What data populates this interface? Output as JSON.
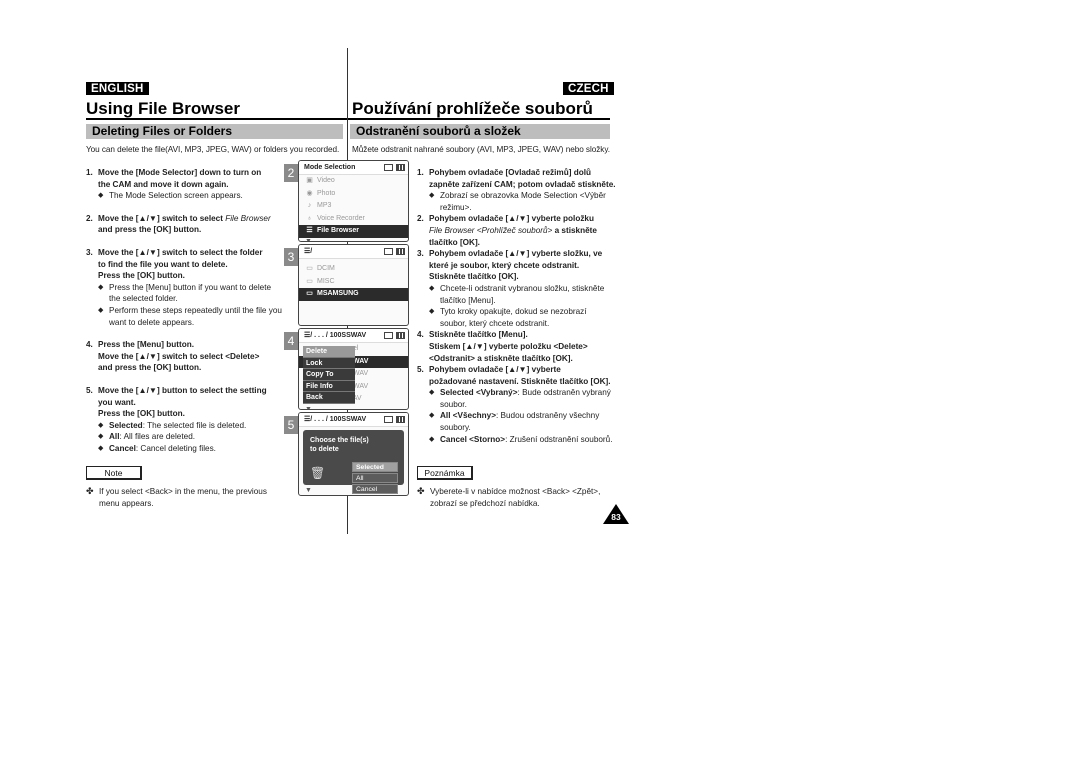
{
  "left": {
    "lang": "ENGLISH",
    "title": "Using File Browser",
    "section": "Deleting Files or Folders",
    "intro": "You can delete the file(AVI, MP3, JPEG, WAV) or folders you recorded.",
    "steps": [
      {
        "num": "1.",
        "lines": [
          "Move the [Mode Selector] down to turn on",
          "the CAM and move it down again."
        ],
        "bullets": [
          "The Mode Selection screen appears."
        ]
      },
      {
        "num": "2.",
        "line1_pre": "Move the [▲/▼] switch to select ",
        "line1_italic": "File Browser",
        "line2": "and press the [OK] button."
      },
      {
        "num": "3.",
        "lines": [
          "Move the [▲/▼] switch to select the folder",
          "to find the file you want to delete.",
          "Press the [OK] button."
        ],
        "bullets": [
          "Press the [Menu] button if you want to delete the selected folder.",
          "Perform these steps repeatedly until the file you want to delete appears."
        ]
      },
      {
        "num": "4.",
        "lines": [
          "Press the [Menu] button.",
          "Move the [▲/▼] switch to select <Delete>",
          "and press the [OK] button."
        ]
      },
      {
        "num": "5.",
        "lines": [
          "Move the [▲/▼] button to select the setting",
          "you want.",
          "Press the [OK] button."
        ],
        "bullets": [
          {
            "term": "Selected",
            "desc": ": The selected file is deleted."
          },
          {
            "term": "All",
            "desc": ": All files are deleted."
          },
          {
            "term": "Cancel",
            "desc": ": Cancel deleting files."
          }
        ]
      }
    ],
    "note_label": "Note",
    "note_text": "If you select <Back> in the menu, the previous menu appears."
  },
  "right": {
    "lang": "CZECH",
    "title": "Používání prohlížeče souborů",
    "section": "Odstranění souborů a složek",
    "intro": "Můžete odstranit nahrané soubory (AVI, MP3, JPEG, WAV) nebo složky.",
    "steps": [
      {
        "num": "1.",
        "lines": [
          "Pohybem ovladače [Ovladač režimů] dolů",
          "zapněte zařízení CAM; potom ovladač stiskněte."
        ],
        "bullets": [
          "Zobrazí se obrazovka Mode Selection <Výběr režimu>."
        ]
      },
      {
        "num": "2.",
        "line1": "Pohybem ovladače [▲/▼] vyberte položku",
        "line2_italic": "File Browser <Prohlížeč souborů>",
        "line2_post": " a stiskněte",
        "line3": "tlačítko [OK]."
      },
      {
        "num": "3.",
        "lines": [
          "Pohybem ovladače [▲/▼] vyberte složku, ve",
          "které je soubor, který chcete odstranit.",
          "Stiskněte tlačítko [OK]."
        ],
        "bullets": [
          "Chcete-li odstranit vybranou složku, stiskněte tlačítko [Menu].",
          "Tyto kroky opakujte, dokud se nezobrazí soubor, který chcete odstranit."
        ]
      },
      {
        "num": "4.",
        "lines": [
          "Stiskněte tlačítko [Menu].",
          "Stiskem [▲/▼] vyberte položku <Delete>",
          "<Odstranit> a stiskněte tlačítko [OK]."
        ]
      },
      {
        "num": "5.",
        "lines": [
          "Pohybem ovladače [▲/▼] vyberte",
          "požadované nastavení. Stiskněte tlačítko [OK]."
        ],
        "bullets": [
          {
            "term": "Selected <Vybraný>",
            "desc": ": Bude odstraněn vybraný soubor."
          },
          {
            "term": "All <Všechny>",
            "desc": ": Budou odstraněny všechny soubory."
          },
          {
            "term": "Cancel <Storno>",
            "desc": ": Zrušení odstranění souborů."
          }
        ]
      }
    ],
    "note_label": "Poznámka",
    "note_text": "Vyberete-li v nabídce možnost <Back> <Zpět>, zobrazí se předchozí nabídka."
  },
  "screens": {
    "s2": {
      "marker": "2",
      "header": "Mode Selection",
      "items": [
        {
          "icon": "video-icon",
          "glyph": "▣",
          "label": "Video"
        },
        {
          "icon": "camera-icon",
          "glyph": "◉",
          "label": "Photo"
        },
        {
          "icon": "music-note-icon",
          "glyph": "♪",
          "label": "MP3"
        },
        {
          "icon": "microphone-icon",
          "glyph": "♁",
          "label": "Voice Recorder"
        },
        {
          "icon": "file-browser-icon",
          "glyph": "☰",
          "label": "File Browser",
          "selected": true
        }
      ]
    },
    "s3": {
      "marker": "3",
      "header": "/",
      "items": [
        {
          "icon": "folder-icon",
          "glyph": "▭",
          "label": "DCIM"
        },
        {
          "icon": "folder-icon",
          "glyph": "▭",
          "label": "MISC"
        },
        {
          "icon": "folder-icon",
          "glyph": "▭",
          "label": "MSAMSUNG",
          "selected": true
        }
      ]
    },
    "s4": {
      "marker": "4",
      "header": "/ . . . / 100SSWAV",
      "bg_rows": [
        "el",
        "WAV",
        "WAV",
        "WAV",
        "SWAV0004.WAV"
      ],
      "menu": [
        "Delete",
        "Lock",
        "Copy To",
        "File Info",
        "Back"
      ],
      "menu_active": "Delete"
    },
    "s5": {
      "marker": "5",
      "header": "/ . . . / 100SSWAV",
      "dialog_line1": "Choose the file(s)",
      "dialog_line2": "to delete",
      "options": [
        "Selected",
        "All",
        "Cancel"
      ],
      "option_active": "Selected"
    }
  },
  "page_number": "83"
}
